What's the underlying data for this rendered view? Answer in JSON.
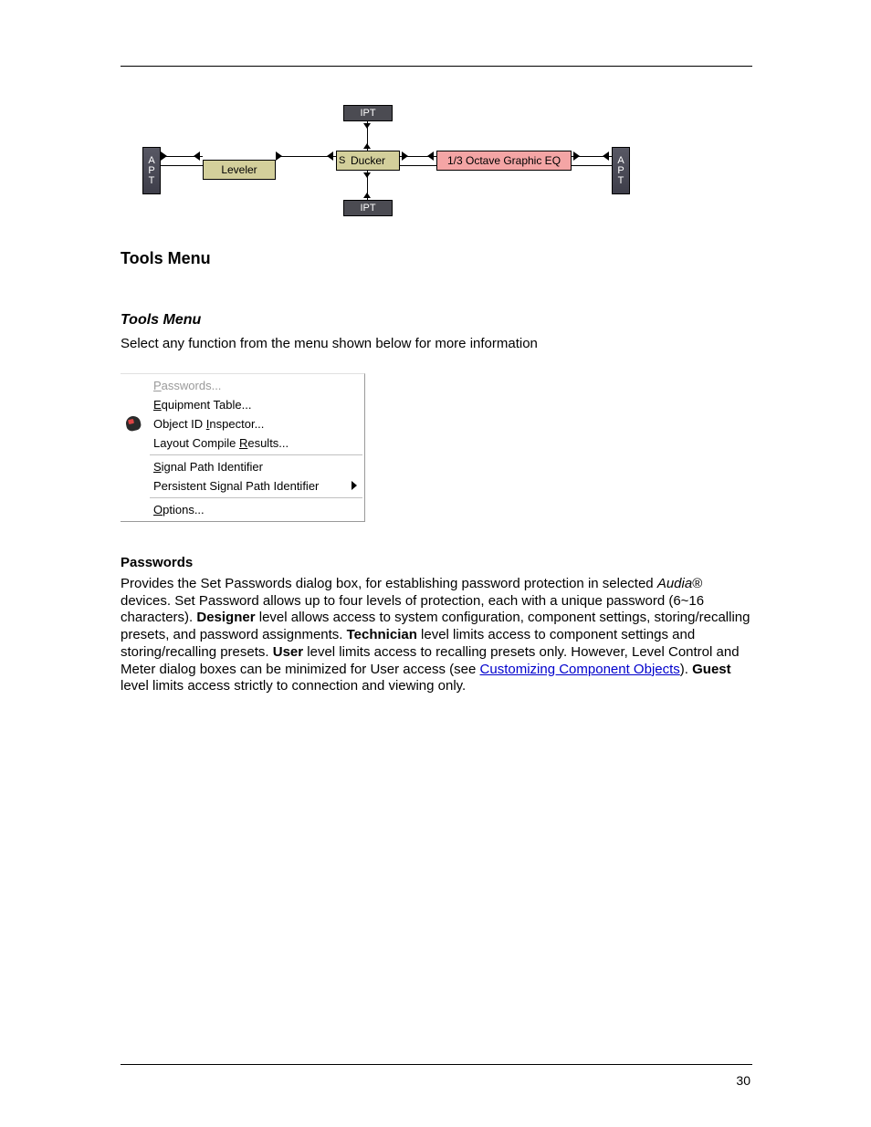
{
  "diagram": {
    "apt_left": "A\nP\nT",
    "apt_right": "A\nP\nT",
    "ipt_top": "IPT",
    "ipt_bottom": "IPT",
    "leveler": "Leveler",
    "ducker": "Ducker",
    "s": "S",
    "eq": "1/3 Octave Graphic EQ"
  },
  "heading_tools": "Tools Menu",
  "heading_tools_sub": "Tools Menu",
  "intro": "Select any function from the menu shown below for more information",
  "menu": {
    "passwords": "Passwords...",
    "equipment": "Equipment Table...",
    "objid": "Object ID Inspector...",
    "layout": "Layout Compile Results...",
    "sigpath": "Signal Path Identifier",
    "persistent": "Persistent Signal Path Identifier",
    "options": "Options..."
  },
  "u": {
    "p": "P",
    "e": "E",
    "i": "I",
    "r": "R",
    "s": "S",
    "o": "O"
  },
  "pw_heading": "Passwords",
  "pw": {
    "p1a": "Provides the Set Passwords dialog box, for establishing password protection in selected ",
    "brand": "Audia",
    "p1b": "® devices. Set Password allows up to four levels of protection, each with a unique password (6~16 characters). ",
    "designer": "Designer",
    "p1c": " level allows access to system configuration, component settings, storing/recalling presets, and password assignments. ",
    "technician": "Technician",
    "p1d": " level limits access to component settings and storing/recalling presets. ",
    "user": "User",
    "p1e": " level limits access to recalling presets only. However, Level Control and Meter dialog boxes can be minimized for User access (see ",
    "link": "Customizing Component Objects",
    "p1f": "). ",
    "guest": "Guest",
    "p1g": " level limits access strictly to connection and viewing only."
  },
  "pagenum": "30"
}
